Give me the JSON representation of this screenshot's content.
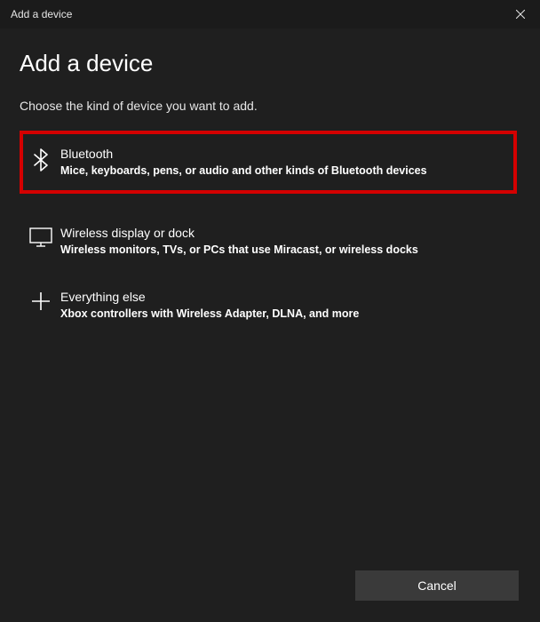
{
  "titlebar": {
    "title": "Add a device"
  },
  "heading": "Add a device",
  "subheading": "Choose the kind of device you want to add.",
  "options": {
    "bluetooth": {
      "title": "Bluetooth",
      "desc": "Mice, keyboards, pens, or audio and other kinds of Bluetooth devices"
    },
    "wireless": {
      "title": "Wireless display or dock",
      "desc": "Wireless monitors, TVs, or PCs that use Miracast, or wireless docks"
    },
    "everything": {
      "title": "Everything else",
      "desc": "Xbox controllers with Wireless Adapter, DLNA, and more"
    }
  },
  "footer": {
    "cancel": "Cancel"
  },
  "highlight_color": "#d40000"
}
